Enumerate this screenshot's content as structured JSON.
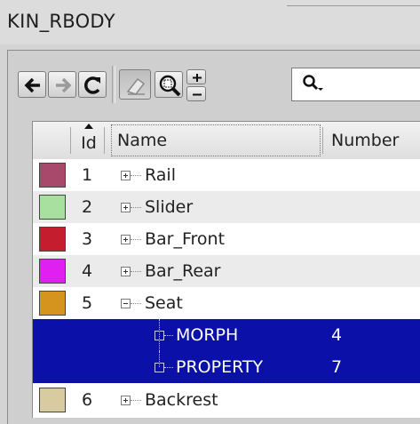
{
  "window": {
    "title": "KIN_RBODY"
  },
  "toolbar": {
    "buttons": [
      {
        "name": "back-icon"
      },
      {
        "name": "forward-icon"
      },
      {
        "name": "refresh-icon"
      },
      {
        "name": "eraser-icon"
      },
      {
        "name": "zoom-fit-icon"
      },
      {
        "name": "zoom-in-icon"
      },
      {
        "name": "zoom-out-icon"
      }
    ],
    "search_icon": "search-icon"
  },
  "table": {
    "columns": {
      "id": "Id",
      "name": "Name",
      "number": "Number"
    },
    "rows": [
      {
        "id": "1",
        "name": "Rail",
        "color": "#a8486a",
        "expander": "+"
      },
      {
        "id": "2",
        "name": "Slider",
        "color": "#a8e0a0",
        "expander": "+"
      },
      {
        "id": "3",
        "name": "Bar_Front",
        "color": "#c41e2e",
        "expander": "+"
      },
      {
        "id": "4",
        "name": "Bar_Rear",
        "color": "#e020f0",
        "expander": "+"
      },
      {
        "id": "5",
        "name": "Seat",
        "color": "#d4941e",
        "expander": "-"
      },
      {
        "id": "",
        "name": "MORPH",
        "number": "4",
        "child": true
      },
      {
        "id": "",
        "name": "PROPERTY",
        "number": "7",
        "child": true
      },
      {
        "id": "6",
        "name": "Backrest",
        "color": "#d8cba0",
        "expander": "+"
      }
    ]
  }
}
